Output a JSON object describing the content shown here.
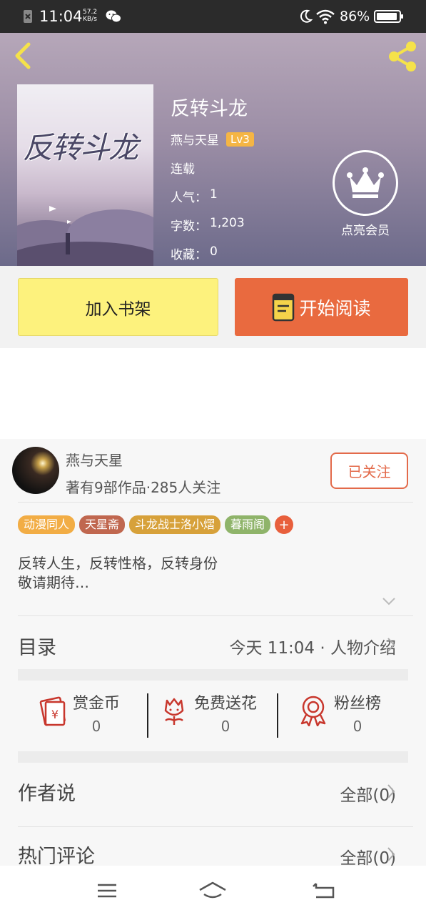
{
  "status_bar": {
    "time": "11:04",
    "net_speed": "57.2",
    "net_unit": "KB/s",
    "battery": "86%"
  },
  "hero": {
    "cover_title": "反转斗龙",
    "title": "反转斗龙",
    "author": "燕与天星",
    "level": "Lv3",
    "status": "连载",
    "popularity_label": "人气：",
    "popularity": "1",
    "words_label": "字数：",
    "words": "1,203",
    "favorites_label": "收藏：",
    "favorites": "0",
    "vip_label": "点亮会员"
  },
  "actions": {
    "add_shelf": "加入书架",
    "start_read": "开始阅读"
  },
  "author_card": {
    "name": "燕与天星",
    "stats": "著有9部作品·285人关注",
    "follow": "已关注"
  },
  "tags": [
    {
      "label": "动漫同人",
      "color": "#f2ad45"
    },
    {
      "label": "天星斋",
      "color": "#c0674f"
    },
    {
      "label": "斗龙战士洛小熠",
      "color": "#d7a13a"
    },
    {
      "label": "暮雨阁",
      "color": "#8fb46a"
    }
  ],
  "tag_add": "+",
  "description": {
    "line1": "反转人生，反转性格，反转身份",
    "line2": "敬请期待…"
  },
  "catalog": {
    "label": "目录",
    "latest": "今天 11:04 · 人物介绍"
  },
  "rewards": [
    {
      "label": "赏金币",
      "value": "0",
      "icon": "red-envelope-icon"
    },
    {
      "label": "免费送花",
      "value": "0",
      "icon": "flower-icon"
    },
    {
      "label": "粉丝榜",
      "value": "0",
      "icon": "medal-icon"
    }
  ],
  "author_says": {
    "label": "作者说",
    "all": "全部(0)"
  },
  "hot_comments": {
    "label": "热门评论",
    "all": "全部(0)"
  },
  "colors": {
    "accent": "#e96a3f",
    "shelf_button": "#fdf27d",
    "follow": "#e36a4a",
    "icon_red": "#c8372d",
    "icon_yellow": "#f5e24a"
  }
}
